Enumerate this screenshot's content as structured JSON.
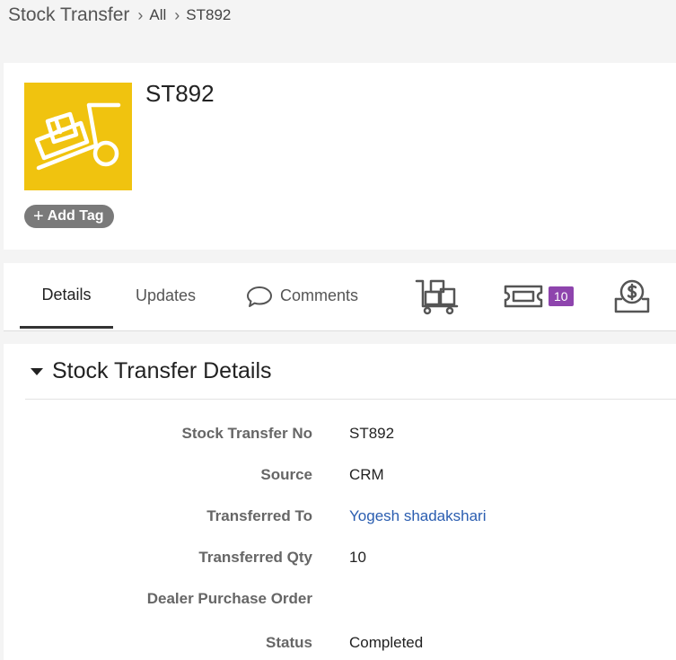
{
  "breadcrumb": {
    "root": "Stock Transfer",
    "link": "All",
    "current": "ST892"
  },
  "record": {
    "title": "ST892",
    "add_tag_label": "Add Tag",
    "icon": "warehouse-trolley-icon",
    "icon_color": "#f0c30f"
  },
  "tabs": [
    {
      "label": "Details",
      "active": true
    },
    {
      "label": "Updates"
    },
    {
      "label": "Comments",
      "icon": "speech-bubble-icon"
    },
    {
      "icon": "trolley-boxes-icon"
    },
    {
      "icon": "ticket-icon",
      "badge": "10"
    },
    {
      "icon": "money-tray-icon"
    }
  ],
  "section": {
    "title": "Stock Transfer Details",
    "expanded": true
  },
  "fields": [
    {
      "label": "Stock Transfer No",
      "value": "ST892"
    },
    {
      "label": "Source",
      "value": "CRM"
    },
    {
      "label": "Transferred To",
      "value": "Yogesh shadakshari",
      "is_link": true
    },
    {
      "label": "Transferred Qty",
      "value": "10"
    },
    {
      "label": "Dealer Purchase Order",
      "value": ""
    },
    {
      "label": "Status",
      "value": "Completed"
    }
  ],
  "colors": {
    "accent_badge": "#8e44ad",
    "link": "#2a5db0"
  }
}
